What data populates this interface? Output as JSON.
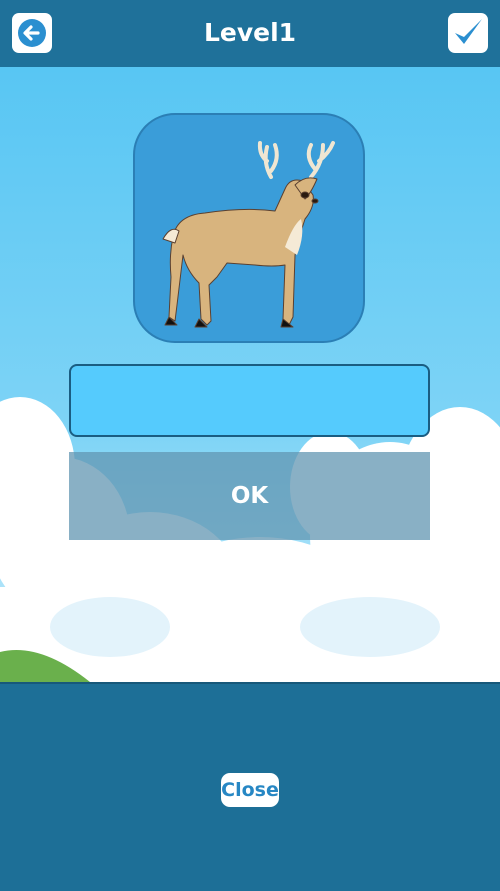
{
  "header": {
    "title": "Level1",
    "back_icon": "arrow-left-icon",
    "confirm_icon": "checkmark-icon"
  },
  "main": {
    "animal_image": "deer",
    "answer_input": {
      "value": "",
      "placeholder": ""
    },
    "ok_label": "OK"
  },
  "footer": {
    "close_label": "Close"
  },
  "colors": {
    "header_bg": "#1f719a",
    "card_bg": "#3a9dd9",
    "input_bg": "#55cbfd",
    "close_text": "#2787c4"
  }
}
